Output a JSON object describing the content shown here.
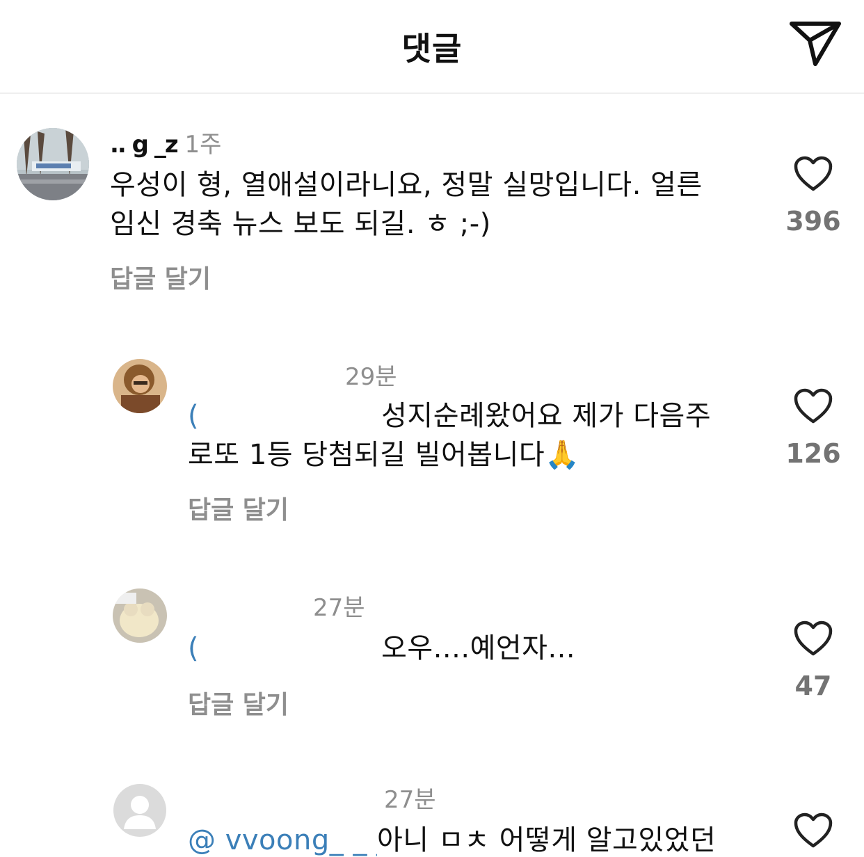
{
  "header": {
    "title": "댓글",
    "share_icon": "send-paper-plane-icon"
  },
  "comments": [
    {
      "username": "..  g  _z",
      "time": "1주",
      "text": "우성이 형, 열애설이라니요, 정말 실망입니다. 얼른 임신 경축 뉴스 보도 되길. ㅎ ;-)",
      "line1": "우성이 형, 열애설이라니요, 정말 실망입니다. 얼른",
      "line2": "임신 경축 뉴스 보도 되길. ㅎ ;-)",
      "reply_label": "답글 달기",
      "likes": "396",
      "avatar": "street-banner-photo"
    },
    {
      "time": "29분",
      "mention": "(",
      "line1": "성지순례왔어요 제가 다음주",
      "line2": "로또 1등 당첨되길 빌어봅니다",
      "emoji": "🙏",
      "reply_label": "답글 달기",
      "likes": "126",
      "avatar": "person-photo"
    },
    {
      "time": "27분",
      "mention": "(",
      "line1": "오우....예언자...",
      "reply_label": "답글 달기",
      "likes": "47",
      "avatar": "cat-photo"
    },
    {
      "time": "27분",
      "mention": "@ vvoong_  _ _ _ _ z",
      "line1": "아니 ㅁㅊ 어떻게 알고있었던",
      "avatar": "default-profile"
    }
  ],
  "colors": {
    "mention": "#3b7fb8",
    "secondary": "#8e8e8e",
    "like_count": "#737373"
  }
}
